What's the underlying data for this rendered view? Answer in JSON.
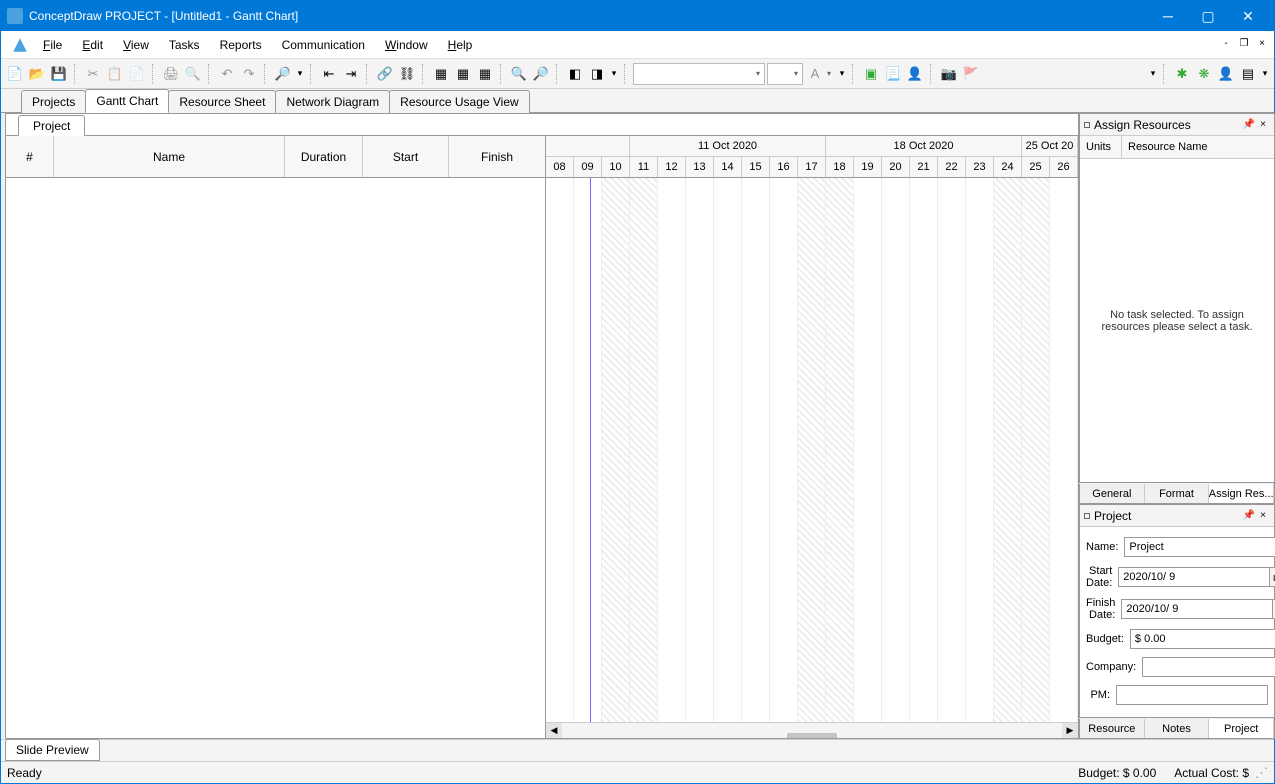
{
  "title": "ConceptDraw PROJECT - [Untitled1 - Gantt Chart]",
  "menu": {
    "file": "File",
    "edit": "Edit",
    "view": "View",
    "tasks": "Tasks",
    "reports": "Reports",
    "communication": "Communication",
    "window": "Window",
    "help": "Help"
  },
  "viewTabs": {
    "projects": "Projects",
    "gantt": "Gantt Chart",
    "resSheet": "Resource Sheet",
    "network": "Network Diagram",
    "resUsage": "Resource Usage View"
  },
  "projectTab": "Project",
  "ganttCols": {
    "num": "#",
    "name": "Name",
    "duration": "Duration",
    "start": "Start",
    "finish": "Finish"
  },
  "weeks": {
    "w1": "11 Oct 2020",
    "w2": "18 Oct 2020",
    "w3": "25 Oct 20"
  },
  "days": [
    "08",
    "09",
    "10",
    "11",
    "12",
    "13",
    "14",
    "15",
    "16",
    "17",
    "18",
    "19",
    "20",
    "21",
    "22",
    "23",
    "24",
    "25",
    "26"
  ],
  "assignRes": {
    "title": "Assign Resources",
    "colUnits": "Units",
    "colName": "Resource Name",
    "empty": "No task selected. To assign resources please select a task."
  },
  "resTabs": {
    "general": "General",
    "format": "Format",
    "assign": "Assign Res..."
  },
  "projPanel": {
    "title": "Project",
    "name": "Name:",
    "nameVal": "Project",
    "start": "Start Date:",
    "startVal": "2020/10/ 9",
    "finish": "Finish Date:",
    "finishVal": "2020/10/ 9",
    "budget": "Budget:",
    "budgetVal": "$ 0.00",
    "company": "Company:",
    "companyVal": "",
    "pm": "PM:",
    "pmVal": ""
  },
  "botTabs": {
    "resource": "Resource",
    "notes": "Notes",
    "project": "Project"
  },
  "slidePreview": "Slide Preview",
  "status": {
    "ready": "Ready",
    "budget": "Budget: $ 0.00",
    "actual": "Actual Cost: $"
  }
}
